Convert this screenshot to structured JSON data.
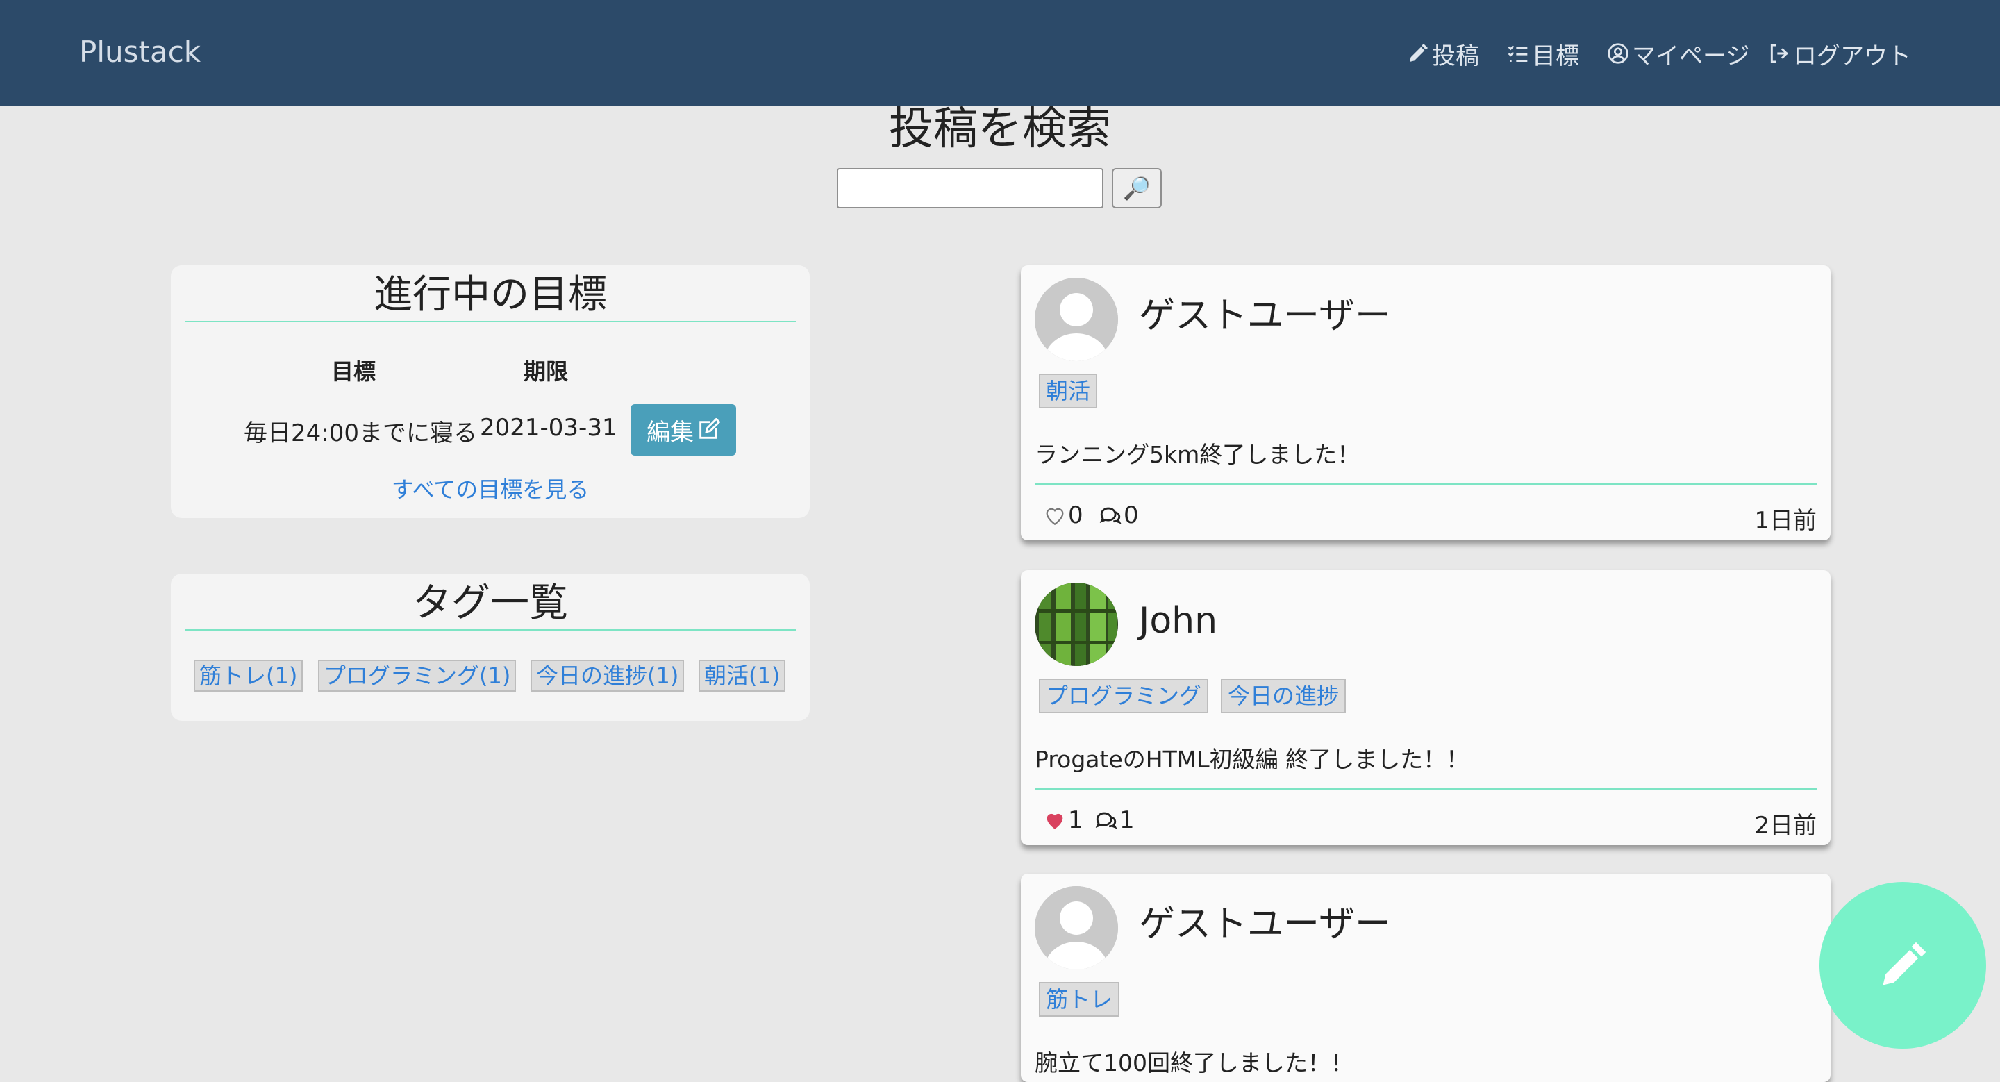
{
  "app": {
    "brand": "Plustack"
  },
  "nav": {
    "post": "投稿",
    "goals": "目標",
    "mypage": "マイページ",
    "logout": "ログアウト"
  },
  "search": {
    "title": "投稿を検索",
    "value": "",
    "button_icon": "🔎"
  },
  "goals": {
    "title": "進行中の目標",
    "header_goal": "目標",
    "header_deadline": "期限",
    "items": [
      {
        "goal": "毎日24:00までに寝る",
        "deadline": "2021-03-31",
        "edit_label": "編集"
      }
    ],
    "all_link": "すべての目標を見る"
  },
  "tags": {
    "title": "タグ一覧",
    "items": [
      "筋トレ(1)",
      "プログラミング(1)",
      "今日の進捗(1)",
      "朝活(1)"
    ]
  },
  "posts": [
    {
      "user": "ゲストユーザー",
      "tags": [
        "朝活"
      ],
      "body": "ランニング5km終了しました！",
      "likes": "0",
      "comments": "0",
      "time": "1日前",
      "liked": false
    },
    {
      "user": "John",
      "tags": [
        "プログラミング",
        "今日の進捗"
      ],
      "body": "ProgateのHTML初級編 終了しました！！",
      "likes": "1",
      "comments": "1",
      "time": "2日前",
      "liked": true
    },
    {
      "user": "ゲストユーザー",
      "tags": [
        "筋トレ"
      ],
      "body": "腕立て100回終了しました！！"
    }
  ],
  "colors": {
    "navbar": "#2c4a69",
    "accent": "#7de4c4",
    "fab": "#79f2c9",
    "edit_button": "#4a9fba",
    "link": "#2f7fd8",
    "like": "#d9415f"
  },
  "icons": {
    "nav_post": "pencil-icon",
    "nav_goals": "checklist-icon",
    "nav_mypage": "user-circle-icon",
    "nav_logout": "sign-out-icon",
    "like": "heart-icon",
    "comment": "comments-icon",
    "fab": "pencil-icon"
  }
}
